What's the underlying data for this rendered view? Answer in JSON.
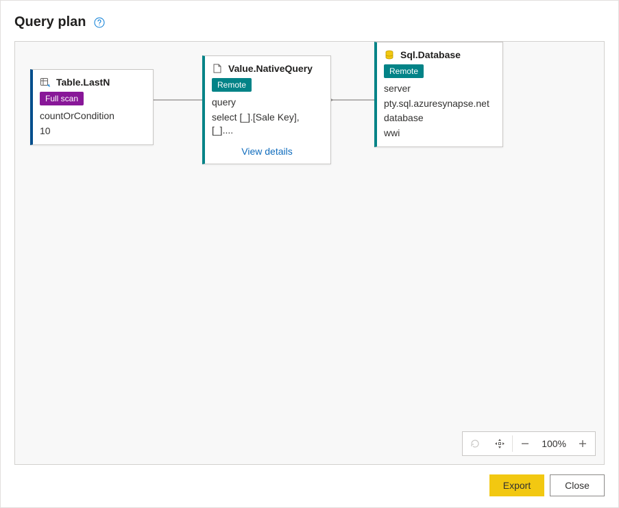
{
  "header": {
    "title": "Query plan"
  },
  "nodes": {
    "table_lastn": {
      "title": "Table.LastN",
      "badge": "Full scan",
      "param_label": "countOrCondition",
      "param_value": "10"
    },
    "native_query": {
      "title": "Value.NativeQuery",
      "badge": "Remote",
      "param_label": "query",
      "param_value": "select [_].[Sale Key], [_]....",
      "link": "View details"
    },
    "sql_database": {
      "title": "Sql.Database",
      "badge": "Remote",
      "server_label": "server",
      "server_value": "pty.sql.azuresynapse.net",
      "database_label": "database",
      "database_value": "wwi"
    }
  },
  "zoom": {
    "level": "100%"
  },
  "footer": {
    "export": "Export",
    "close": "Close"
  }
}
